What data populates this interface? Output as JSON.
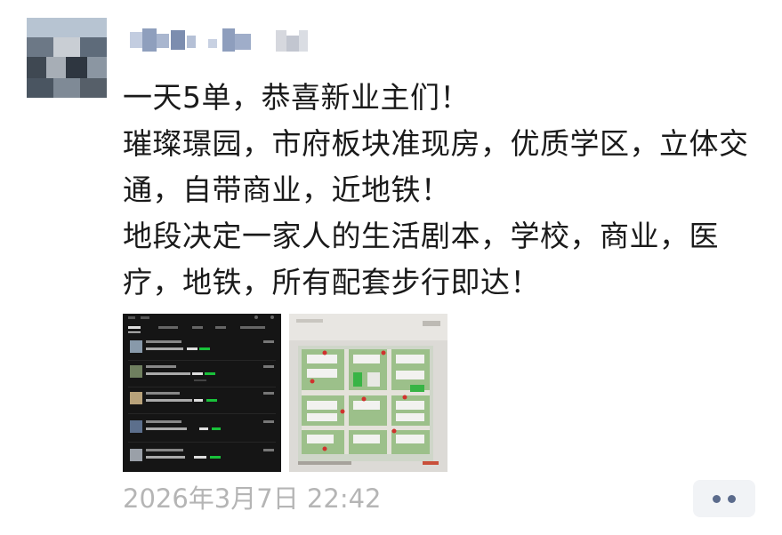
{
  "post": {
    "author_name": "",
    "lines": [
      "一天5单，恭喜新业主们！",
      "璀璨璟园，市府板块准现房，优质学区，立体交通，自带商业，近地铁！",
      "地段决定一家人的生活剧本，学校，商业，医疗，地铁，所有配套步行即达！"
    ],
    "timestamp": "2026年3月7日 22:42"
  },
  "images": [
    {
      "name": "chat-screenshot",
      "dark_background": "#151515",
      "accent": "#19c13a"
    },
    {
      "name": "site-plan-photo",
      "background": "#d8d7d3",
      "accent": "#38b445"
    }
  ],
  "icons": {
    "more": "ellipsis-icon"
  },
  "colors": {
    "text": "#1a1a1a",
    "timestamp": "#b5b5b5",
    "more_button_bg": "#f1f3f6",
    "more_dots": "#5b6b8c"
  }
}
